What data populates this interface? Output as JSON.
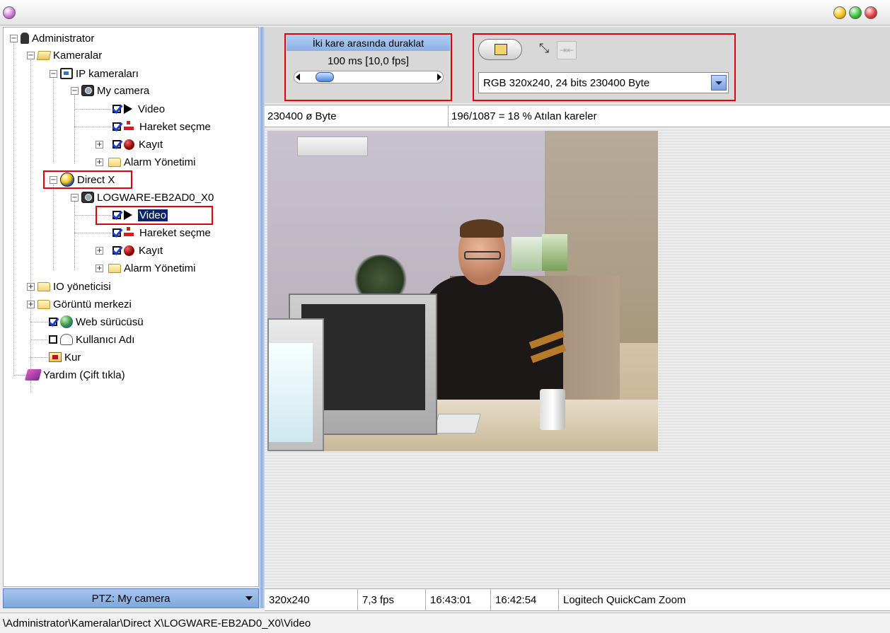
{
  "tree": {
    "administrator": "Administrator",
    "kameralar": "Kameralar",
    "ip_kameralari": "IP kameraları",
    "my_camera": "My camera",
    "my_camera_video": "Video",
    "my_camera_motion": "Hareket seçme",
    "my_camera_record": "Kayıt",
    "my_camera_alarm": "Alarm Yönetimi",
    "direct_x": "Direct X",
    "logware": "LOGWARE-EB2AD0_X0",
    "logware_video": "Video",
    "logware_motion": "Hareket seçme",
    "logware_record": "Kayıt",
    "logware_alarm": "Alarm Yönetimi",
    "io": "IO yöneticisi",
    "gorunti": "Görüntü merkezi",
    "web": "Web sürücüsü",
    "kullanici": "Kullanıcı Adı",
    "kur": "Kur",
    "yardim": "Yardım (Çift tıkla)"
  },
  "ptz": {
    "label": "PTZ: My camera"
  },
  "frame_rate": {
    "header": "İki kare arasında duraklat",
    "value": "100 ms [10,0 fps]",
    "slider_position": 0.12
  },
  "format": {
    "selected": "RGB 320x240, 24 bits 230400 Byte"
  },
  "info": {
    "bytes": "230400 ø Byte",
    "dropped": "196/1087 = 18 % Atılan kareler"
  },
  "status": {
    "resolution": "320x240",
    "fps": "7,3 fps",
    "time1": "16:43:01",
    "time2": "16:42:54",
    "device": "Logitech QuickCam Zoom"
  },
  "path": "\\Administrator\\Kameralar\\Direct X\\LOGWARE-EB2AD0_X0\\Video",
  "colors": {
    "highlight_box": "#e0000a",
    "selection": "#0a246a",
    "ptz_bar": "#7ea6dc"
  },
  "icons": {
    "window": "window-orb-icon",
    "minimize": "yellow-orb-icon",
    "maximize": "green-orb-icon",
    "close": "red-orb-icon"
  }
}
